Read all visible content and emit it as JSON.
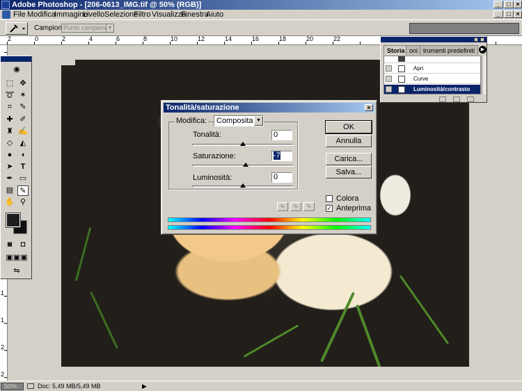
{
  "window": {
    "title": "Adobe Photoshop - [206-0613_IMG.tif @ 50% (RGB)]",
    "controls": [
      "_",
      "□",
      "×"
    ]
  },
  "document_controls": [
    "_",
    "□",
    "×"
  ],
  "menu": [
    "File",
    "Modifica",
    "Immagine",
    "Livello",
    "Selezione",
    "Filtro",
    "Visualizza",
    "Finestra",
    "Aiuto"
  ],
  "options_bar": {
    "sample_label": "Campione:",
    "sample_value": "Punto campione"
  },
  "ruler": {
    "h_ticks": [
      "2",
      "0",
      "2",
      "4",
      "6",
      "8",
      "10",
      "12",
      "14",
      "16",
      "18",
      "20",
      "22"
    ],
    "v_ticks": [
      "0",
      "2",
      "4",
      "6",
      "8",
      "1",
      "1",
      "1",
      "1",
      "1",
      "2",
      "2"
    ]
  },
  "history": {
    "tabs": [
      "Storia",
      "oni",
      "trumenti predefiniti"
    ],
    "items": [
      {
        "label": "Apri",
        "selected": false
      },
      {
        "label": "Curve",
        "selected": false
      },
      {
        "label": "Luminosità/contrasto",
        "selected": true
      }
    ]
  },
  "dialog": {
    "title": "Tonalità/saturazione",
    "close": "×",
    "modifica_label": "Modifica:",
    "modifica_value": "Composita",
    "sliders": [
      {
        "label": "Tonalità:",
        "value": "0",
        "position": 0.5
      },
      {
        "label": "Saturazione:",
        "value": "-7",
        "position": 0.53
      },
      {
        "label": "Luminosità:",
        "value": "0",
        "position": 0.5
      }
    ],
    "buttons": [
      "OK",
      "Annulla",
      "Carica...",
      "Salva..."
    ],
    "checkboxes": [
      {
        "label": "Colora",
        "checked": false,
        "mark": ""
      },
      {
        "label": "Anteprima",
        "checked": true,
        "mark": "✓"
      }
    ]
  },
  "status": {
    "zoom": "50%",
    "doc": "Doc: 5,49 MB/5,49 MB",
    "arrow": "▶"
  },
  "colors": {
    "titlebar": "#0a246a",
    "foreground_swatch": "#1e1e1e",
    "background_swatch": "#111111"
  }
}
